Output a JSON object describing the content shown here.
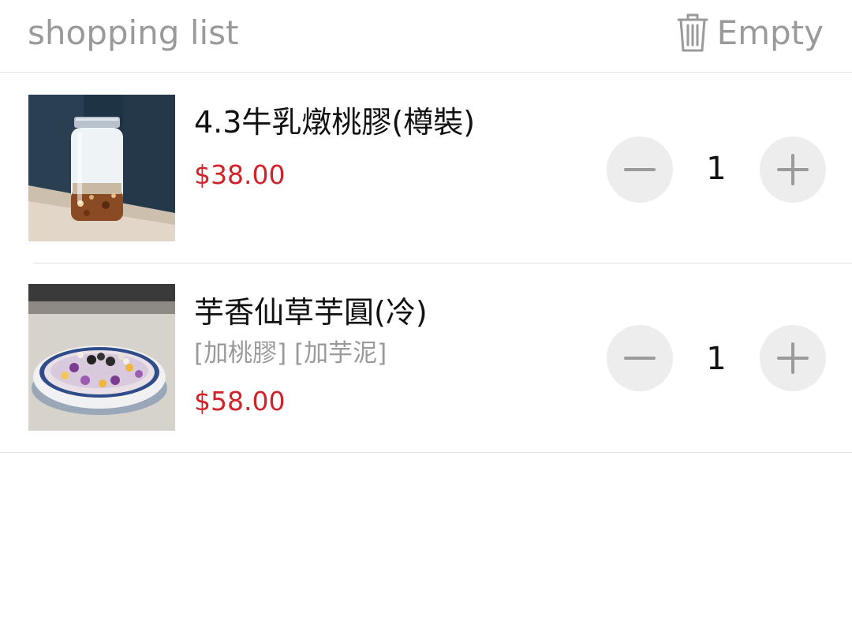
{
  "header": {
    "title": "shopping list",
    "empty_label": "Empty",
    "empty_icon": "trash-icon"
  },
  "items": [
    {
      "name": "4.3牛乳燉桃膠(樽裝)",
      "options": "",
      "price": "$38.00",
      "quantity": "1",
      "image": "milk-peach-gum-jar-photo"
    },
    {
      "name": "芋香仙草芋圓(冷)",
      "options": "[加桃膠] [加芋泥]",
      "price": "$58.00",
      "quantity": "1",
      "image": "taro-grass-jelly-bowl-photo"
    }
  ],
  "colors": {
    "price": "#d2232a",
    "muted": "#9a9a9a",
    "stepper_bg": "#ededed"
  }
}
